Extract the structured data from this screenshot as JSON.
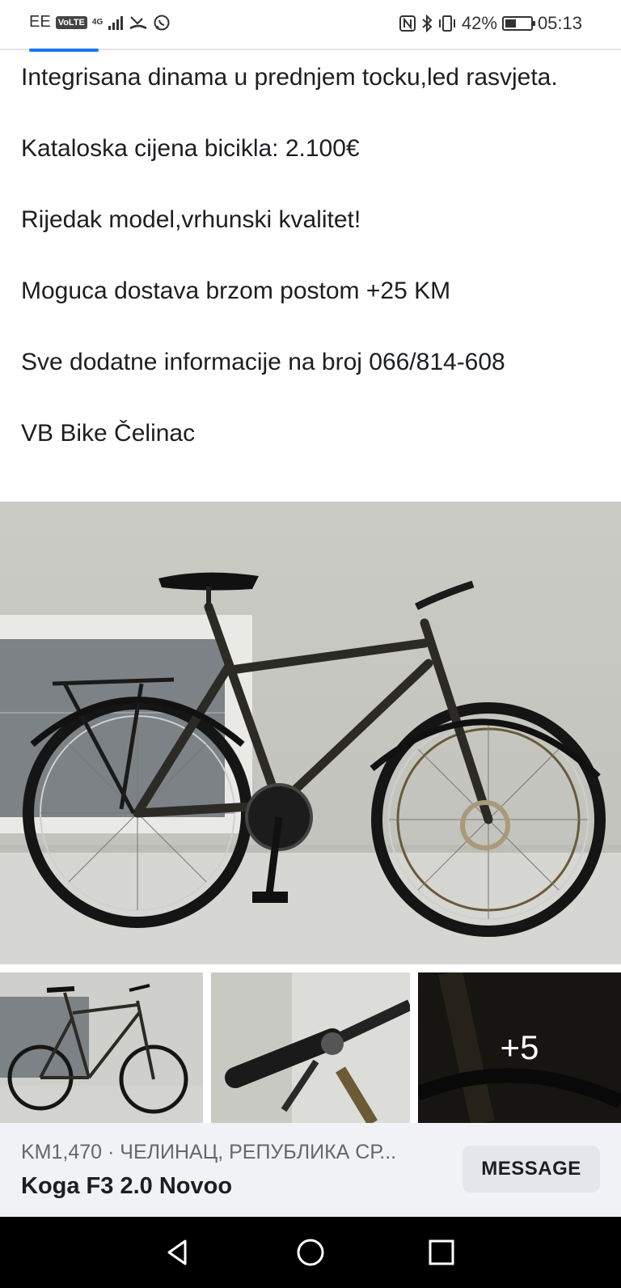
{
  "status_bar": {
    "carrier": "EE",
    "volte": "VoLTE",
    "network": "4G",
    "battery_percent": "42%",
    "battery_level": 0.42,
    "time": "05:13",
    "icons": [
      "signal-icon",
      "missed-call-icon",
      "whatsapp-icon",
      "nfc-icon",
      "bluetooth-icon",
      "vibrate-icon"
    ]
  },
  "page_progress": 0.11,
  "description": [
    "Integrisana dinama u prednjem tocku,led rasvjeta.",
    "Kataloska cijena bicikla: 2.100€",
    "Rijedak model,vrhunski kvalitet!",
    "Moguca dostava brzom postom +25 KM",
    "Sve dodatne informacije na broj 066/814-608",
    "VB Bike Čelinac"
  ],
  "gallery": {
    "main_image": "bicycle-photo",
    "thumbnails": [
      "bicycle-photo-thumb",
      "handlebar-photo-thumb",
      "fork-photo-thumb"
    ],
    "more_count": "+5"
  },
  "listing": {
    "price_location": "KM1,470 · ЧЕЛИНАЦ, РЕПУБЛИКА СР...",
    "title": "Koga F3 2.0 Novoo",
    "message_button": "MESSAGE"
  },
  "nav": {
    "icons": [
      "back-icon",
      "home-icon",
      "recent-apps-icon"
    ]
  },
  "colors": {
    "accent": "#1877f2",
    "footer_bg": "#f0f2f5",
    "button_bg": "#e4e6eb"
  }
}
